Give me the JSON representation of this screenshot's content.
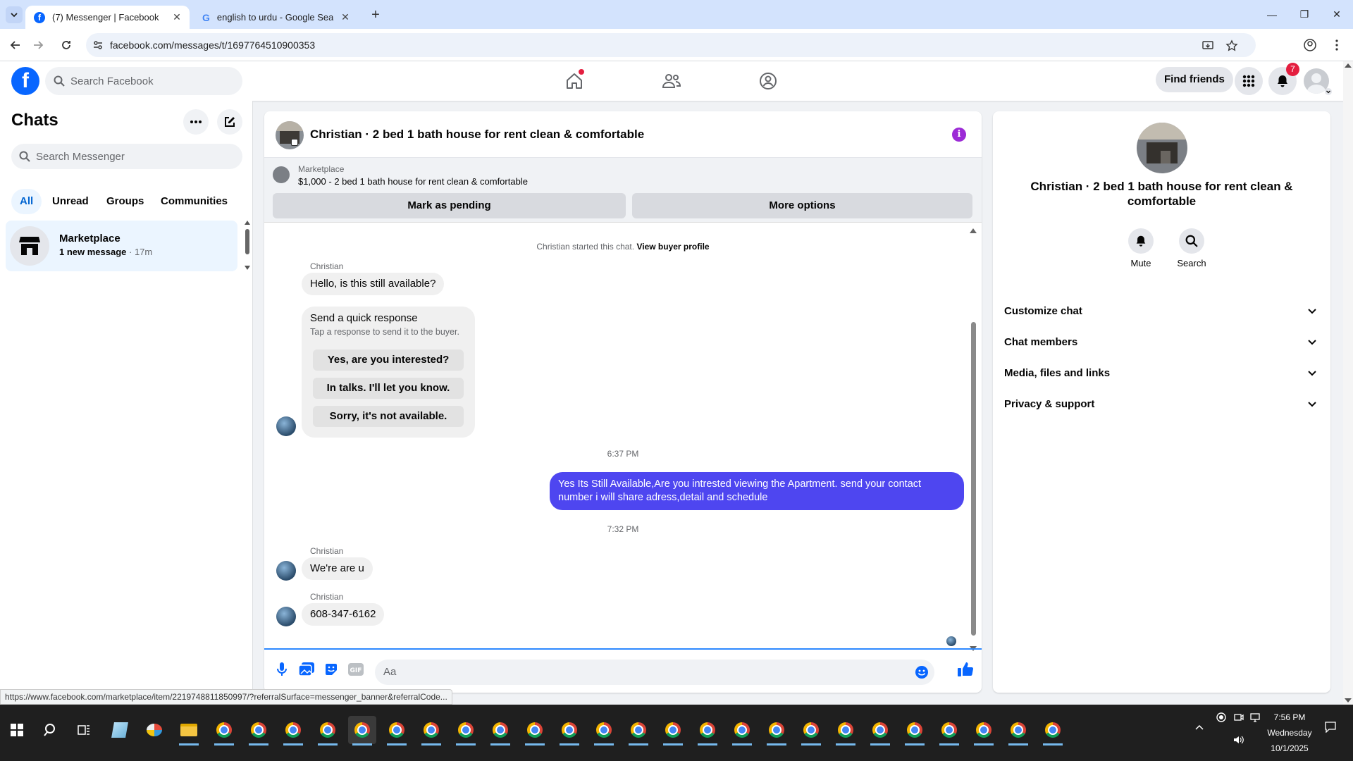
{
  "browser": {
    "tabs": [
      {
        "title": "(7) Messenger | Facebook",
        "icon": "facebook-icon",
        "active": true
      },
      {
        "title": "english to urdu - Google Search",
        "icon": "google-icon",
        "active": false
      }
    ],
    "url": "facebook.com/messages/t/1697764510900353",
    "status_url": "https://www.facebook.com/marketplace/item/2219748811850997/?referralSurface=messenger_banner&referralCode..."
  },
  "fb_header": {
    "search_placeholder": "Search Facebook",
    "find_friends": "Find friends",
    "notifications_count": "7",
    "brand_color": "#0866ff"
  },
  "chats": {
    "title": "Chats",
    "search_placeholder": "Search Messenger",
    "filters": [
      "All",
      "Unread",
      "Groups",
      "Communities"
    ],
    "active_filter": "All",
    "items": [
      {
        "name": "Marketplace",
        "preview": "1 new message",
        "time": "17m"
      }
    ]
  },
  "conversation": {
    "title": "Christian · 2 bed 1 bath house for rent clean & comfortable",
    "banner": {
      "label": "Marketplace",
      "listing": "$1,000 - 2 bed 1 bath house for rent clean & comfortable",
      "mark_pending": "Mark as pending",
      "more_options": "More options"
    },
    "started_note": "Christian started this chat.",
    "view_buyer_profile": "View buyer profile",
    "messages": {
      "sender": "Christian",
      "first": "Hello, is this still available?",
      "quick_title": "Send a quick response",
      "quick_sub": "Tap a response to send it to the buyer.",
      "quick_replies": [
        "Yes, are you interested?",
        "In talks. I'll let you know.",
        "Sorry, it's not available."
      ],
      "time1": "6:37 PM",
      "outgoing": "Yes Its Still Available,Are you intrested viewing the Apartment. send your contact number i will share adress,detail and schedule",
      "time2": "7:32 PM",
      "reply1": "We're are u",
      "reply2": "608-347-6162"
    },
    "input_placeholder": "Aa",
    "outgoing_color": "#4e46f0"
  },
  "info_panel": {
    "name": "Christian · 2 bed 1 bath house for rent clean & comfortable",
    "actions": [
      "Mute",
      "Search"
    ],
    "sections": [
      "Customize chat",
      "Chat members",
      "Media, files and links",
      "Privacy & support"
    ]
  },
  "taskbar": {
    "time": "7:56 PM",
    "day": "Wednesday",
    "date": "10/1/2025"
  }
}
